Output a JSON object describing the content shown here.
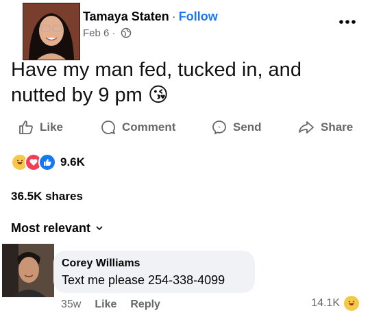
{
  "post": {
    "author": "Tamaya Staten",
    "separator": "·",
    "follow": "Follow",
    "date": "Feb 6",
    "date_separator": "·",
    "text": "Have my man fed, tucked in, and nutted by 9 pm",
    "emoji": "😘"
  },
  "actions": {
    "like": "Like",
    "comment": "Comment",
    "send": "Send",
    "share": "Share"
  },
  "reactions": {
    "count": "9.6K",
    "icons": [
      "haha-icon",
      "love-icon",
      "like-icon"
    ]
  },
  "shares": "36.5K shares",
  "sort": "Most relevant",
  "comment": {
    "author": "Corey Williams",
    "text": "Text me please 254-338-4099",
    "age": "35w",
    "like": "Like",
    "reply": "Reply",
    "reaction_count": "14.1K",
    "reaction_icon": "haha-icon"
  },
  "colors": {
    "accent": "#1877f2",
    "secondary_text": "#65676b",
    "bubble": "#f0f2f5"
  }
}
